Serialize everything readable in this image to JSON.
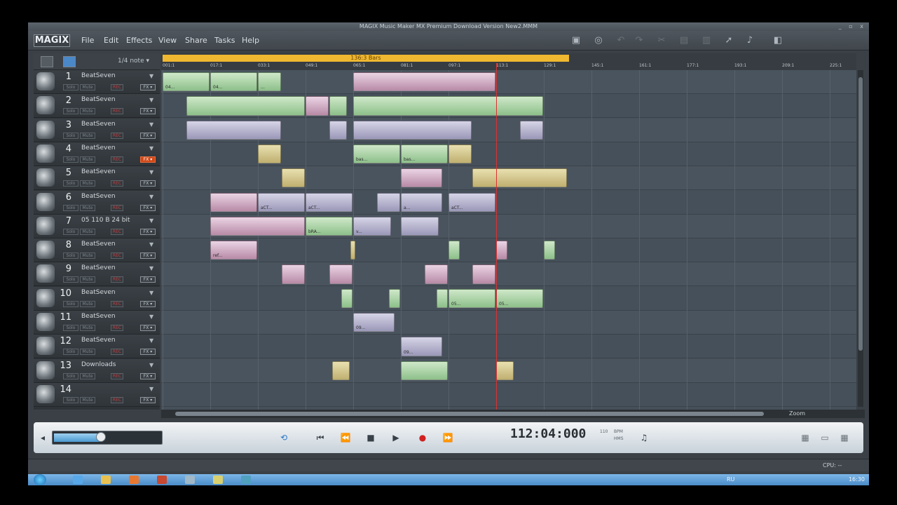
{
  "window": {
    "title": "MAGIX Music Maker MX Premium Download Version     New2.MMM",
    "controls": "_ ▫ x"
  },
  "menubar": {
    "logo": "MAGIX",
    "items": [
      "File",
      "Edit",
      "Effects",
      "View",
      "Share",
      "Tasks",
      "Help"
    ]
  },
  "toolbar": {
    "icons": [
      "save-icon",
      "undo-icon",
      "redo-icon",
      "cut-icon",
      "copy-icon",
      "paste-icon",
      "mouse-mode-icon",
      "note-icon",
      "dock-icon"
    ]
  },
  "trackpanel": {
    "note_select": "1/4 note ▾"
  },
  "tracks": [
    {
      "num": "1",
      "name": "BeatSeven",
      "solo": "Solo",
      "mute": "Mute",
      "rec": "REC",
      "fx": "FX ▾",
      "fx_on": false
    },
    {
      "num": "2",
      "name": "BeatSeven",
      "solo": "Solo",
      "mute": "Mute",
      "rec": "REC",
      "fx": "FX ▾",
      "fx_on": false
    },
    {
      "num": "3",
      "name": "BeatSeven",
      "solo": "Solo",
      "mute": "Mute",
      "rec": "REC",
      "fx": "FX ▾",
      "fx_on": false
    },
    {
      "num": "4",
      "name": "BeatSeven",
      "solo": "Solo",
      "mute": "Mute",
      "rec": "REC",
      "fx": "FX ▾",
      "fx_on": true
    },
    {
      "num": "5",
      "name": "BeatSeven",
      "solo": "Solo",
      "mute": "Mute",
      "rec": "REC",
      "fx": "FX ▾",
      "fx_on": false
    },
    {
      "num": "6",
      "name": "BeatSeven",
      "solo": "Solo",
      "mute": "Mute",
      "rec": "REC",
      "fx": "FX ▾",
      "fx_on": false
    },
    {
      "num": "7",
      "name": "05 110 B 24 bit",
      "solo": "Solo",
      "mute": "Mute",
      "rec": "REC",
      "fx": "FX ▾",
      "fx_on": false
    },
    {
      "num": "8",
      "name": "BeatSeven",
      "solo": "Solo",
      "mute": "Mute",
      "rec": "REC",
      "fx": "FX ▾",
      "fx_on": false
    },
    {
      "num": "9",
      "name": "BeatSeven",
      "solo": "Solo",
      "mute": "Mute",
      "rec": "REC",
      "fx": "FX ▾",
      "fx_on": false
    },
    {
      "num": "10",
      "name": "BeatSeven",
      "solo": "Solo",
      "mute": "Mute",
      "rec": "REC",
      "fx": "FX ▾",
      "fx_on": false
    },
    {
      "num": "11",
      "name": "BeatSeven",
      "solo": "Solo",
      "mute": "Mute",
      "rec": "REC",
      "fx": "FX ▾",
      "fx_on": false
    },
    {
      "num": "12",
      "name": "BeatSeven",
      "solo": "Solo",
      "mute": "Mute",
      "rec": "REC",
      "fx": "FX ▾",
      "fx_on": false
    },
    {
      "num": "13",
      "name": "Downloads",
      "solo": "Solo",
      "mute": "Mute",
      "rec": "REC",
      "fx": "FX ▾",
      "fx_on": false
    },
    {
      "num": "14",
      "name": "",
      "solo": "Solo",
      "mute": "Mute",
      "rec": "REC",
      "fx": "FX ▾",
      "fx_on": false
    }
  ],
  "ruler": {
    "loop_label": "136:3 Bars",
    "marks": [
      "001:1",
      "017:1",
      "033:1",
      "049:1",
      "065:1",
      "081:1",
      "097:1",
      "113:1",
      "129:1",
      "145:1",
      "161:1",
      "177:1",
      "193:1",
      "209:1",
      "225:1"
    ]
  },
  "clips": [
    {
      "track": 0,
      "bar": 1,
      "len": 16,
      "color": "green",
      "label": "04..."
    },
    {
      "track": 0,
      "bar": 17,
      "len": 16,
      "color": "green",
      "label": "04..."
    },
    {
      "track": 0,
      "bar": 33,
      "len": 8,
      "color": "green",
      "label": "..."
    },
    {
      "track": 0,
      "bar": 65,
      "len": 48,
      "color": "pink",
      "label": ""
    },
    {
      "track": 1,
      "bar": 9,
      "len": 40,
      "color": "green",
      "label": ""
    },
    {
      "track": 1,
      "bar": 49,
      "len": 8,
      "color": "pink",
      "label": ""
    },
    {
      "track": 1,
      "bar": 57,
      "len": 6,
      "color": "green",
      "label": ""
    },
    {
      "track": 1,
      "bar": 65,
      "len": 64,
      "color": "green",
      "label": ""
    },
    {
      "track": 2,
      "bar": 9,
      "len": 32,
      "color": "violet",
      "label": ""
    },
    {
      "track": 2,
      "bar": 57,
      "len": 6,
      "color": "violet",
      "label": ""
    },
    {
      "track": 2,
      "bar": 65,
      "len": 40,
      "color": "violet",
      "label": ""
    },
    {
      "track": 2,
      "bar": 121,
      "len": 8,
      "color": "violet",
      "label": ""
    },
    {
      "track": 3,
      "bar": 33,
      "len": 8,
      "color": "khaki",
      "label": ""
    },
    {
      "track": 3,
      "bar": 65,
      "len": 16,
      "color": "green",
      "label": "bas..."
    },
    {
      "track": 3,
      "bar": 81,
      "len": 16,
      "color": "green",
      "label": "bas..."
    },
    {
      "track": 3,
      "bar": 97,
      "len": 8,
      "color": "khaki",
      "label": ""
    },
    {
      "track": 4,
      "bar": 41,
      "len": 8,
      "color": "khaki",
      "label": ""
    },
    {
      "track": 4,
      "bar": 81,
      "len": 14,
      "color": "pink",
      "label": ""
    },
    {
      "track": 4,
      "bar": 105,
      "len": 32,
      "color": "khaki",
      "label": ""
    },
    {
      "track": 5,
      "bar": 17,
      "len": 16,
      "color": "pink",
      "label": ""
    },
    {
      "track": 5,
      "bar": 33,
      "len": 16,
      "color": "violet",
      "label": "aCT..."
    },
    {
      "track": 5,
      "bar": 49,
      "len": 16,
      "color": "violet",
      "label": "aCT..."
    },
    {
      "track": 5,
      "bar": 73,
      "len": 8,
      "color": "violet",
      "label": ""
    },
    {
      "track": 5,
      "bar": 81,
      "len": 14,
      "color": "violet",
      "label": "a..."
    },
    {
      "track": 5,
      "bar": 97,
      "len": 16,
      "color": "violet",
      "label": "aCT..."
    },
    {
      "track": 6,
      "bar": 17,
      "len": 32,
      "color": "pink",
      "label": ""
    },
    {
      "track": 6,
      "bar": 49,
      "len": 16,
      "color": "green",
      "label": "bRA..."
    },
    {
      "track": 6,
      "bar": 65,
      "len": 13,
      "color": "violet",
      "label": "v..."
    },
    {
      "track": 6,
      "bar": 81,
      "len": 13,
      "color": "violet",
      "label": ""
    },
    {
      "track": 7,
      "bar": 17,
      "len": 16,
      "color": "pink",
      "label": "ref..."
    },
    {
      "track": 7,
      "bar": 64,
      "len": 2,
      "color": "khaki",
      "label": ""
    },
    {
      "track": 7,
      "bar": 97,
      "len": 4,
      "color": "green",
      "label": ""
    },
    {
      "track": 7,
      "bar": 113,
      "len": 4,
      "color": "pink",
      "label": ""
    },
    {
      "track": 7,
      "bar": 129,
      "len": 4,
      "color": "green",
      "label": ""
    },
    {
      "track": 8,
      "bar": 41,
      "len": 8,
      "color": "pink",
      "label": ""
    },
    {
      "track": 8,
      "bar": 57,
      "len": 8,
      "color": "pink",
      "label": ""
    },
    {
      "track": 8,
      "bar": 89,
      "len": 8,
      "color": "pink",
      "label": ""
    },
    {
      "track": 8,
      "bar": 105,
      "len": 8,
      "color": "pink",
      "label": ""
    },
    {
      "track": 9,
      "bar": 61,
      "len": 4,
      "color": "green",
      "label": ""
    },
    {
      "track": 9,
      "bar": 77,
      "len": 4,
      "color": "green",
      "label": ""
    },
    {
      "track": 9,
      "bar": 93,
      "len": 4,
      "color": "green",
      "label": ""
    },
    {
      "track": 9,
      "bar": 97,
      "len": 16,
      "color": "green",
      "label": "05..."
    },
    {
      "track": 9,
      "bar": 113,
      "len": 16,
      "color": "green",
      "label": "05..."
    },
    {
      "track": 10,
      "bar": 65,
      "len": 14,
      "color": "violet",
      "label": "09..."
    },
    {
      "track": 11,
      "bar": 81,
      "len": 14,
      "color": "violet",
      "label": "09..."
    },
    {
      "track": 12,
      "bar": 58,
      "len": 6,
      "color": "khaki",
      "label": ""
    },
    {
      "track": 12,
      "bar": 81,
      "len": 16,
      "color": "green",
      "label": ""
    },
    {
      "track": 12,
      "bar": 113,
      "len": 6,
      "color": "khaki",
      "label": ""
    }
  ],
  "playhead_bar": 113,
  "hscroll": {
    "zoom_label": "Zoom"
  },
  "transport": {
    "volume_percent": 45,
    "time": "112:04:000",
    "bpm_value": "110",
    "bpm_label": "BPM",
    "hms_label": "HMS"
  },
  "statusbar": {
    "cpu": "CPU: --"
  },
  "taskbar": {
    "lang": "RU",
    "clock": "16:30"
  },
  "colors": {
    "playhead": "#e03030",
    "loop": "#f0b830",
    "fx_on": "#d04818"
  }
}
